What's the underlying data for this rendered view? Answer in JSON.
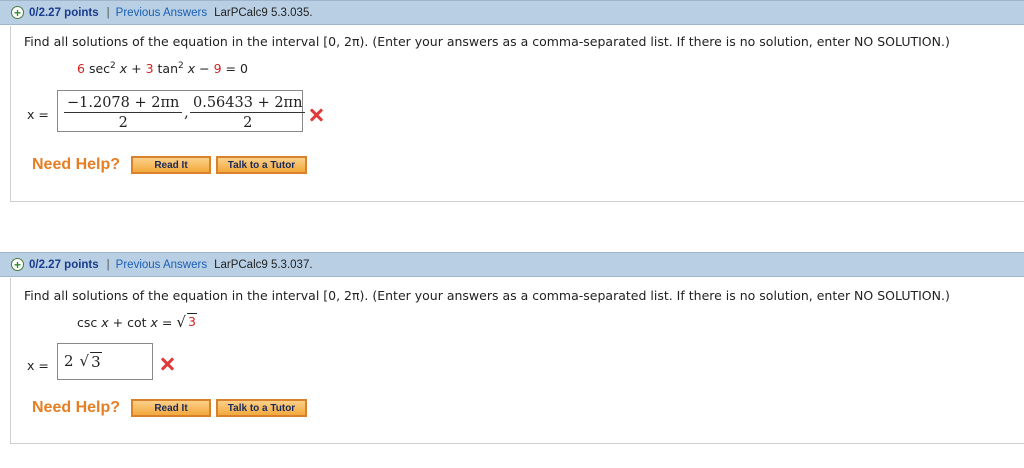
{
  "questions": [
    {
      "points": "0/2.27 points",
      "separator": "|",
      "previous_answers": "Previous Answers",
      "ref": "LarPCalc9 5.3.035.",
      "prompt": "Find all solutions of the equation in the interval [0, 2π). (Enter your answers as a comma-separated list. If there is no solution, enter NO SOLUTION.)",
      "equation": {
        "coef1": "6",
        "term1": "sec",
        "exp1": "2",
        "var1": "x",
        "op1": "+",
        "coef2": "3",
        "term2": "tan",
        "exp2": "2",
        "var2": "x",
        "op2": "−",
        "const": "9",
        "eq": "=",
        "rhs": "0"
      },
      "answer_label": "x =",
      "answer": {
        "frac1_num": "−1.2078 + 2πn",
        "frac1_den": "2",
        "comma": ",",
        "frac2_num": "0.56433 + 2πn",
        "frac2_den": "2"
      },
      "status_icon": "x-mark-icon",
      "need_help": "Need Help?",
      "read_it": "Read It",
      "talk_tutor": "Talk to a Tutor"
    },
    {
      "points": "0/2.27 points",
      "separator": "|",
      "previous_answers": "Previous Answers",
      "ref": "LarPCalc9 5.3.037.",
      "prompt": "Find all solutions of the equation in the interval [0, 2π). (Enter your answers as a comma-separated list. If there is no solution, enter NO SOLUTION.)",
      "equation": {
        "term1": "csc",
        "var1": "x",
        "op1": "+",
        "term2": "cot",
        "var2": "x",
        "eq": "=",
        "radical": "√",
        "radicand": "3"
      },
      "answer_label": "x =",
      "answer": {
        "coef": "2",
        "radical": "√",
        "radicand": "3"
      },
      "status_icon": "x-mark-icon",
      "need_help": "Need Help?",
      "read_it": "Read It",
      "talk_tutor": "Talk to a Tutor"
    }
  ],
  "colors": {
    "header_bg": "#b9cfe4",
    "points_text": "#1a3c8c",
    "link": "#1a5fb4",
    "wrong": "#e03a3a",
    "need_help": "#e67e22",
    "button_bg": "#f3a93c"
  }
}
